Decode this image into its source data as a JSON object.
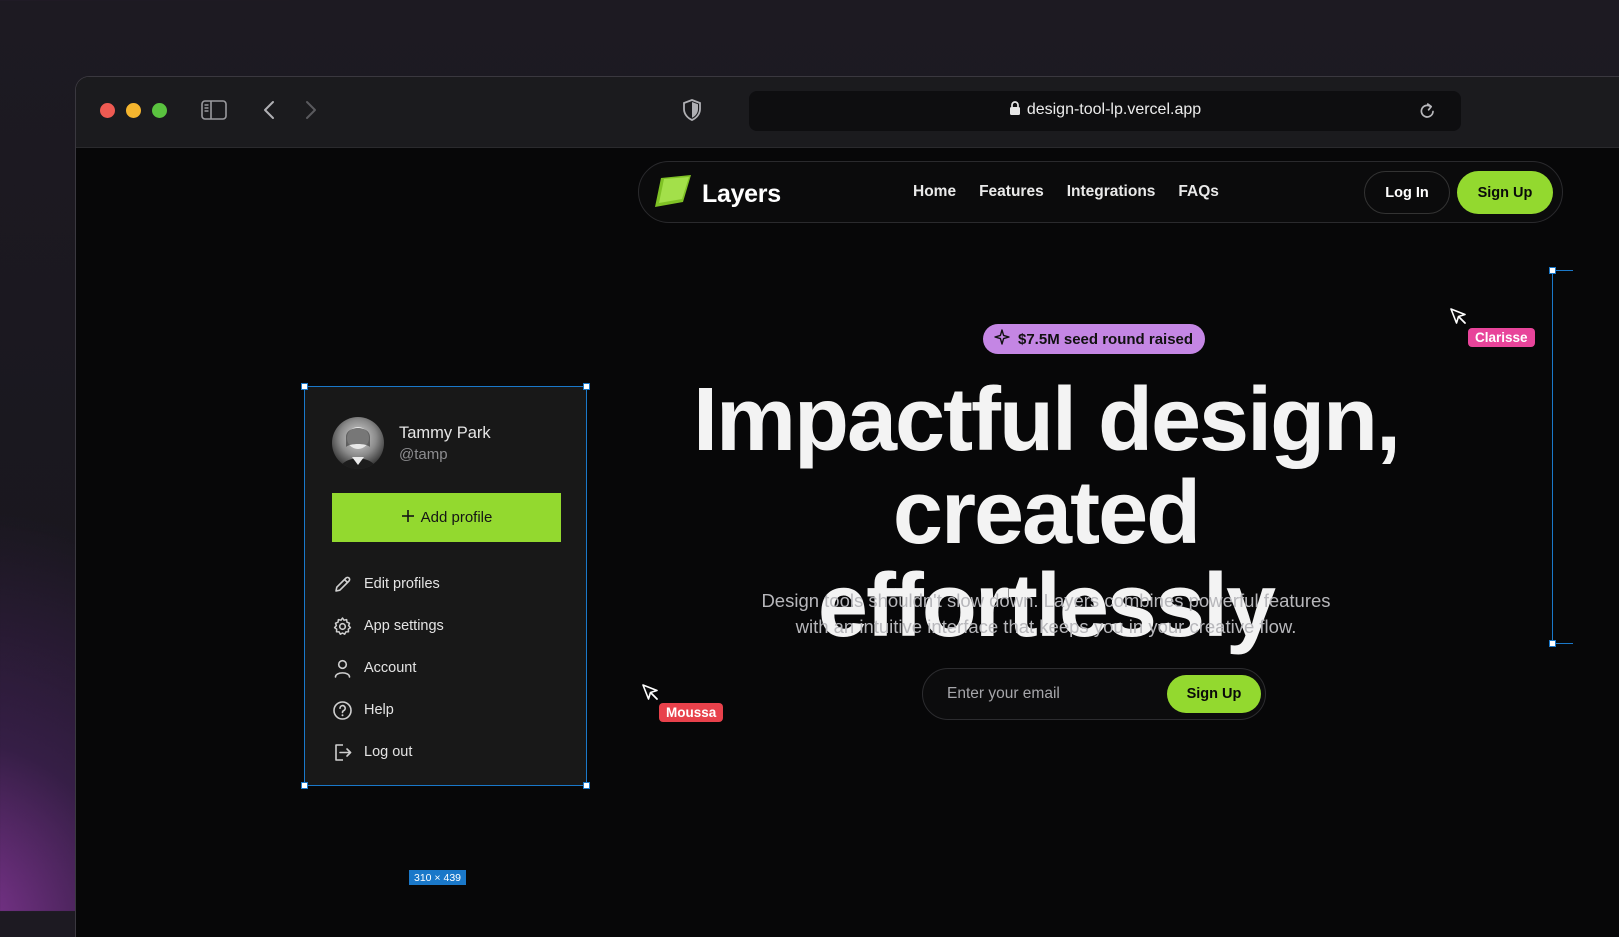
{
  "browser": {
    "url": "design-tool-lp.vercel.app",
    "lights": [
      "#ee5a52",
      "#f5b52e",
      "#5ac23f"
    ]
  },
  "nav": {
    "brand": "Layers",
    "links": [
      "Home",
      "Features",
      "Integrations",
      "FAQs"
    ],
    "login": "Log In",
    "signup": "Sign Up"
  },
  "hero": {
    "badge": "$7.5M seed round raised",
    "title_line1": "Impactful design,",
    "title_line2": "created effortlessly",
    "subtitle": "Design tools shouldn't slow down. Layers combines powerful features with an intuitive interface that keeps you in your creative flow.",
    "email_placeholder": "Enter your email",
    "cta": "Sign Up"
  },
  "cursors": {
    "clarisse": {
      "name": "Clarisse",
      "color": "#e8449a"
    },
    "moussa": {
      "name": "Moussa",
      "color": "#e8414b"
    }
  },
  "panel": {
    "name": "Tammy Park",
    "handle": "@tamp",
    "add_profile": "Add profile",
    "items": [
      {
        "label": "Edit profiles",
        "icon": "pencil-icon"
      },
      {
        "label": "App settings",
        "icon": "gear-icon"
      },
      {
        "label": "Account",
        "icon": "user-icon"
      },
      {
        "label": "Help",
        "icon": "help-icon"
      },
      {
        "label": "Log out",
        "icon": "logout-icon"
      }
    ],
    "dimensions": "310 × 439"
  },
  "colors": {
    "accent": "#93d92f",
    "selection": "#1a78c9",
    "badge": "#c486e4"
  }
}
